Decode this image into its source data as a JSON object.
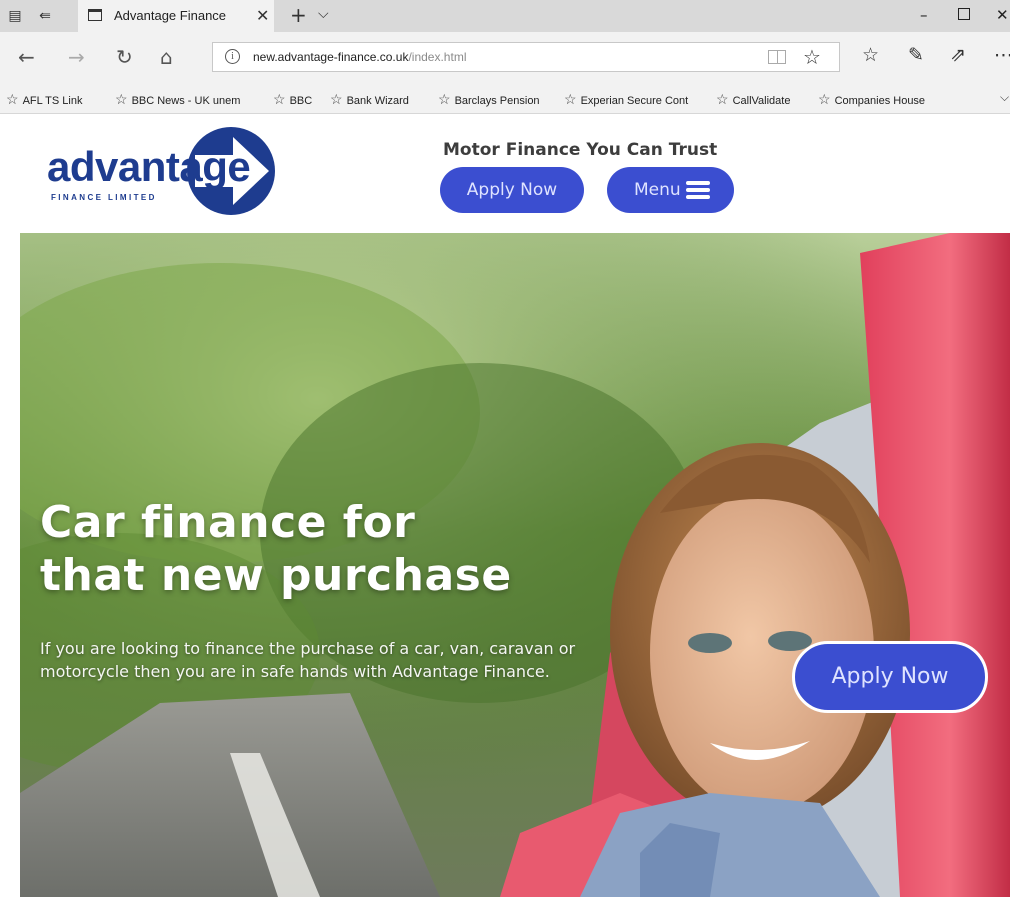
{
  "browser": {
    "tab_title": "Advantage Finance",
    "url_host": "new.advantage-finance.co.uk",
    "url_path": "/index.html",
    "favorites": [
      "AFL TS Link",
      "BBC News - UK unem",
      "BBC",
      "Bank Wizard",
      "Barclays Pension",
      "Experian Secure Cont",
      "CallValidate",
      "Companies House"
    ]
  },
  "header": {
    "logo_word": "advantage",
    "logo_sub": "FINANCE LIMITED",
    "tagline": "Motor Finance You Can Trust",
    "apply_label": "Apply Now",
    "menu_label": "Menu"
  },
  "hero": {
    "title_line1": "Car finance for",
    "title_line2": "that new purchase",
    "text": "If you are looking to finance the purchase of a car, van, caravan or motorcycle then you are in safe hands with Advantage Finance.",
    "apply_label": "Apply Now"
  },
  "colors": {
    "brand_blue": "#1e3c8f",
    "button_blue": "#3b4ed0"
  }
}
